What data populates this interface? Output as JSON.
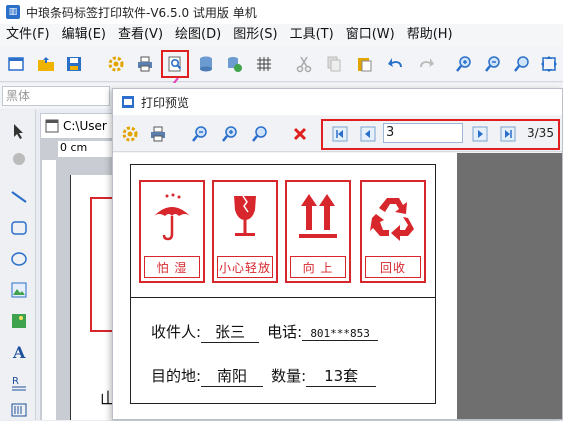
{
  "app": {
    "title": "中琅条码标签打印软件-V6.5.0 试用版 单机"
  },
  "menu": [
    "文件(F)",
    "编辑(E)",
    "查看(V)",
    "绘图(D)",
    "图形(S)",
    "工具(T)",
    "窗口(W)",
    "帮助(H)"
  ],
  "font_box": {
    "value": "黑体"
  },
  "doc_tab": {
    "label": "C:\\User"
  },
  "ruler": {
    "label": "0 cm"
  },
  "preview": {
    "title": "打印预览",
    "page_input": "3",
    "page_count": "3/35"
  },
  "label": {
    "symbols": [
      "怕 湿",
      "小心轻放",
      "向 上",
      "回收"
    ],
    "recipient_label": "收件人:",
    "recipient_value": "张三",
    "phone_label": "电话:",
    "phone_value": "801***853",
    "dest_label": "目的地:",
    "dest_value": "南阳",
    "qty_label": "数量:",
    "qty_value": "13套"
  },
  "behind_text": "山",
  "colors": {
    "accent_red": "#d7262c",
    "highlight": "#e02020"
  }
}
